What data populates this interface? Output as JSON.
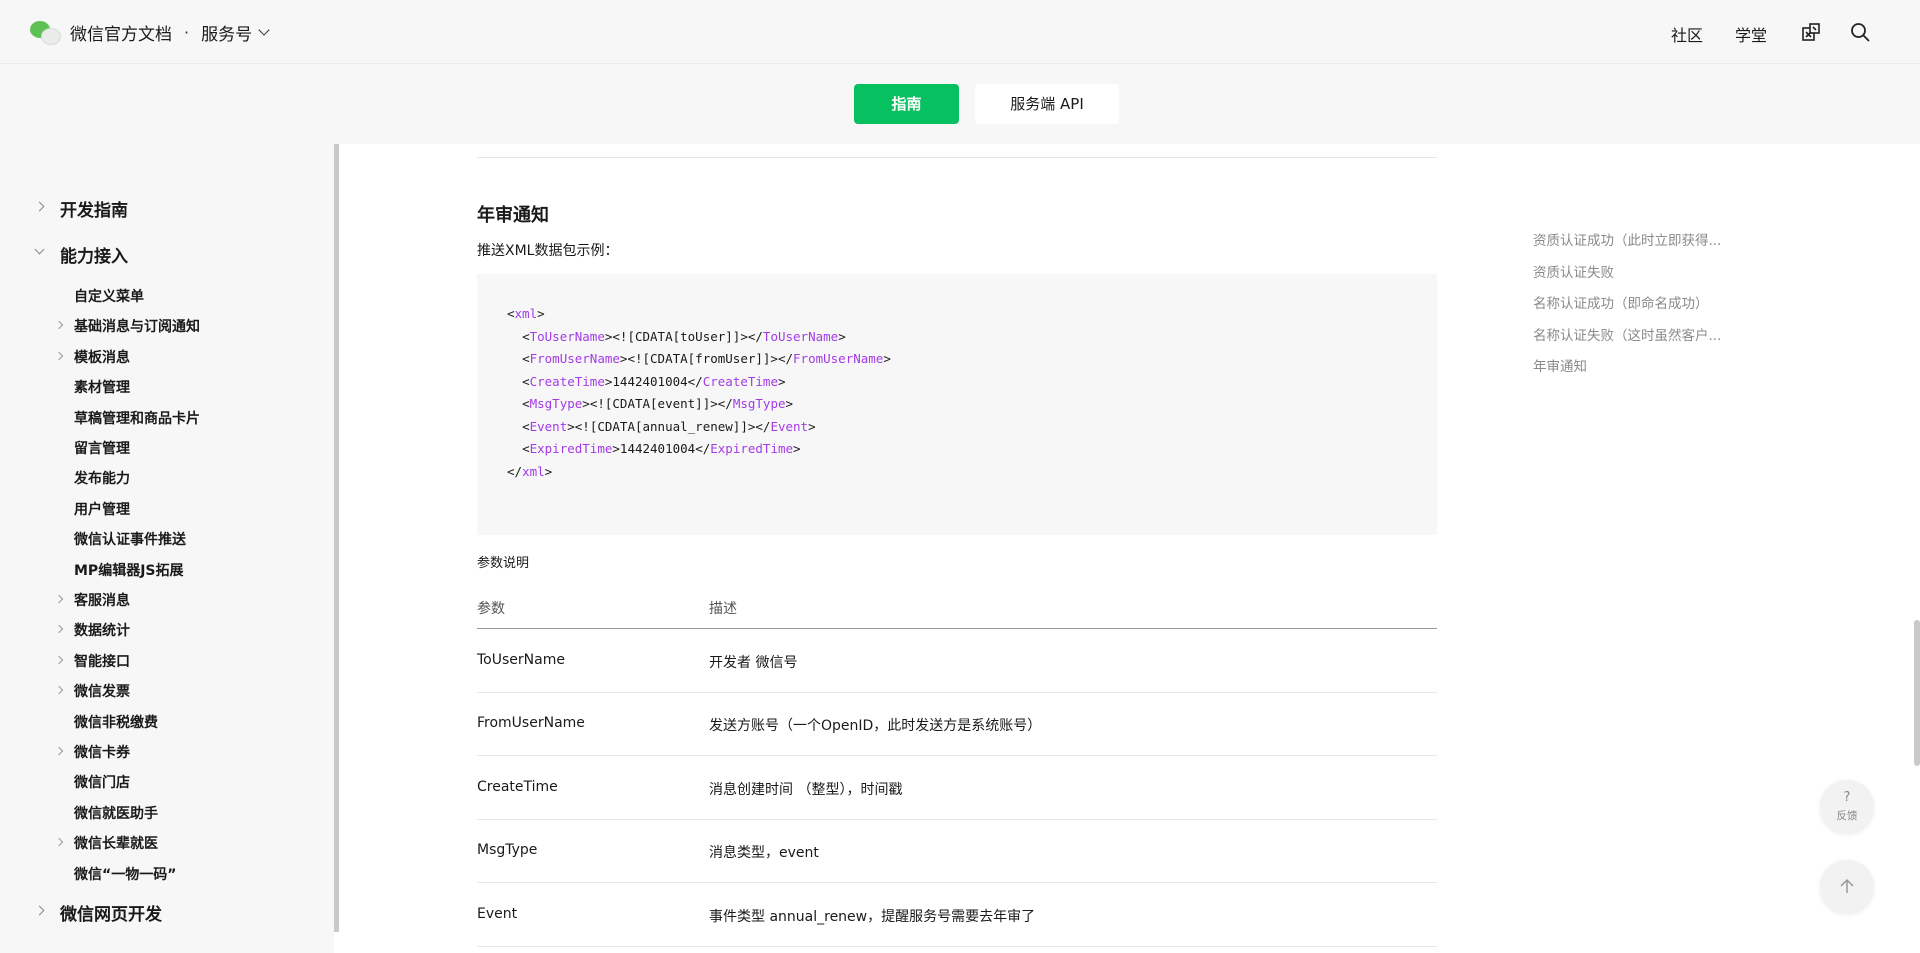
{
  "header": {
    "title": "微信官方文档",
    "separator": "·",
    "product": "服务号",
    "links": {
      "community": "社区",
      "academy": "学堂"
    },
    "icons": {
      "logo": "wechat-logo",
      "dropdown": "chevron-down-icon",
      "tools": "devtools-icon",
      "search": "search-icon"
    }
  },
  "tabs": {
    "guide": "指南",
    "server_api": "服务端 API"
  },
  "sidebar": {
    "top_items": [
      "开发指南",
      "能力接入",
      "微信网页开发"
    ],
    "sub_items": [
      {
        "label": "自定义菜单",
        "expandable": false
      },
      {
        "label": "基础消息与订阅通知",
        "expandable": true
      },
      {
        "label": "模板消息",
        "expandable": true
      },
      {
        "label": "素材管理",
        "expandable": false
      },
      {
        "label": "草稿管理和商品卡片",
        "expandable": false
      },
      {
        "label": "留言管理",
        "expandable": false
      },
      {
        "label": "发布能力",
        "expandable": false
      },
      {
        "label": "用户管理",
        "expandable": false
      },
      {
        "label": "微信认证事件推送",
        "expandable": false
      },
      {
        "label": "MP编辑器JS拓展",
        "expandable": false
      },
      {
        "label": "客服消息",
        "expandable": true
      },
      {
        "label": "数据统计",
        "expandable": true
      },
      {
        "label": "智能接口",
        "expandable": true
      },
      {
        "label": "微信发票",
        "expandable": true
      },
      {
        "label": "微信非税缴费",
        "expandable": false
      },
      {
        "label": "微信卡券",
        "expandable": true
      },
      {
        "label": "微信门店",
        "expandable": false
      },
      {
        "label": "微信就医助手",
        "expandable": false
      },
      {
        "label": "微信长辈就医",
        "expandable": true
      },
      {
        "label": "微信“一物一码”",
        "expandable": false
      }
    ]
  },
  "content": {
    "section_title": "年审通知",
    "intro": "推送XML数据包示例：",
    "code": {
      "root_tag": "xml",
      "fields": [
        {
          "tag": "ToUserName",
          "value": "<![CDATA[toUser]]>"
        },
        {
          "tag": "FromUserName",
          "value": "<![CDATA[fromUser]]>"
        },
        {
          "tag": "CreateTime",
          "value": "1442401004"
        },
        {
          "tag": "MsgType",
          "value": "<![CDATA[event]]>"
        },
        {
          "tag": "Event",
          "value": "<![CDATA[annual_renew]]>"
        },
        {
          "tag": "ExpiredTime",
          "value": "1442401004"
        }
      ]
    },
    "params_title": "参数说明",
    "table": {
      "headers": [
        "参数",
        "描述"
      ],
      "rows": [
        [
          "ToUserName",
          "开发者 微信号"
        ],
        [
          "FromUserName",
          "发送方账号（一个OpenID，此时发送方是系统账号）"
        ],
        [
          "CreateTime",
          "消息创建时间 （整型），时间戳"
        ],
        [
          "MsgType",
          "消息类型，event"
        ],
        [
          "Event",
          "事件类型 annual_renew，提醒服务号需要去年审了"
        ]
      ]
    }
  },
  "toc": [
    "资质认证成功（此时立即获得...",
    "资质认证失败",
    "名称认证成功（即命名成功）",
    "名称认证失败（这时虽然客户...",
    "年审通知"
  ],
  "floating": {
    "feedback_label": "反馈",
    "feedback_symbol": "?",
    "back_to_top_icon": "arrow-up-icon"
  },
  "colors": {
    "accent": "#07c160",
    "code_tag": "#a33be6",
    "sidebar_bg": "#f7f7f7"
  }
}
